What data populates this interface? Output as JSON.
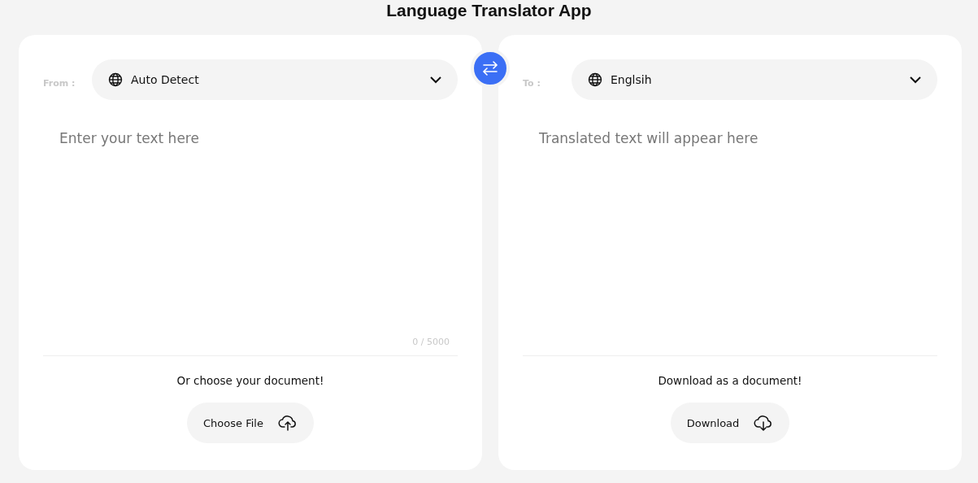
{
  "title": "Language Translator App",
  "source": {
    "label": "From :",
    "language": "Auto Detect",
    "placeholder": "Enter your text here",
    "counter": "0 / 5000",
    "prompt": "Or choose your document!",
    "button": "Choose File"
  },
  "target": {
    "label": "To :",
    "language": "Englsih",
    "placeholder": "Translated text will appear here",
    "prompt": "Download as a document!",
    "button": "Download"
  }
}
